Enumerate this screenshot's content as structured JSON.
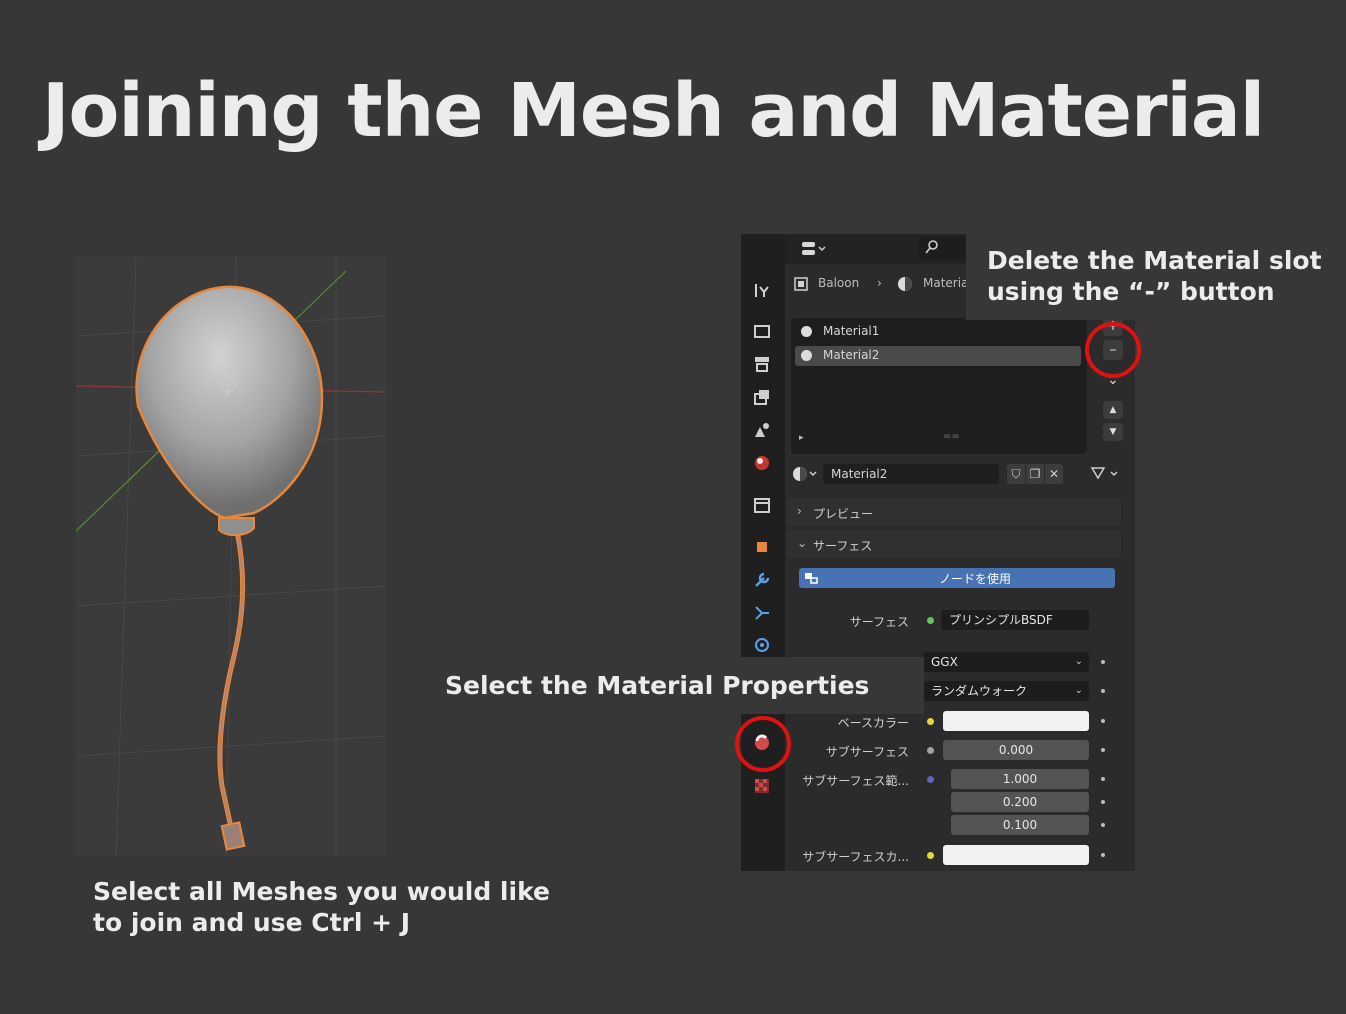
{
  "slide": {
    "title": "Joining the Mesh and Material",
    "caption_join": "Select all Meshes you would like to join and use Ctrl + J",
    "caption_select": "Select the Material Properties",
    "caption_delete": "Delete the Material slot using the “-” button"
  },
  "blender": {
    "breadcrumb": {
      "object": "Baloon",
      "material": "Materia"
    },
    "material_slots": [
      {
        "label": "Material1"
      },
      {
        "label": "Material2"
      }
    ],
    "active_material": "Material2",
    "sections": {
      "preview": "プレビュー",
      "surface": "サーフェス"
    },
    "use_nodes_label": "ノードを使用",
    "surface_prop": {
      "label": "サーフェス",
      "value": "プリンシプルBSDF"
    },
    "distribution": "GGX",
    "subsurface_method": "ランダムウォーク",
    "base_color_label": "ベースカラー",
    "subsurface": {
      "label": "サブサーフェス",
      "value": "0.000"
    },
    "subsurface_radius": {
      "label": "サブサーフェス範...",
      "values": [
        "1.000",
        "0.200",
        "0.100"
      ]
    },
    "subsurface_color_label": "サブサーフェスカ...",
    "colors": {
      "accent": "#4772b3",
      "highlight": "#e11111",
      "selection": "#e8873a"
    }
  }
}
